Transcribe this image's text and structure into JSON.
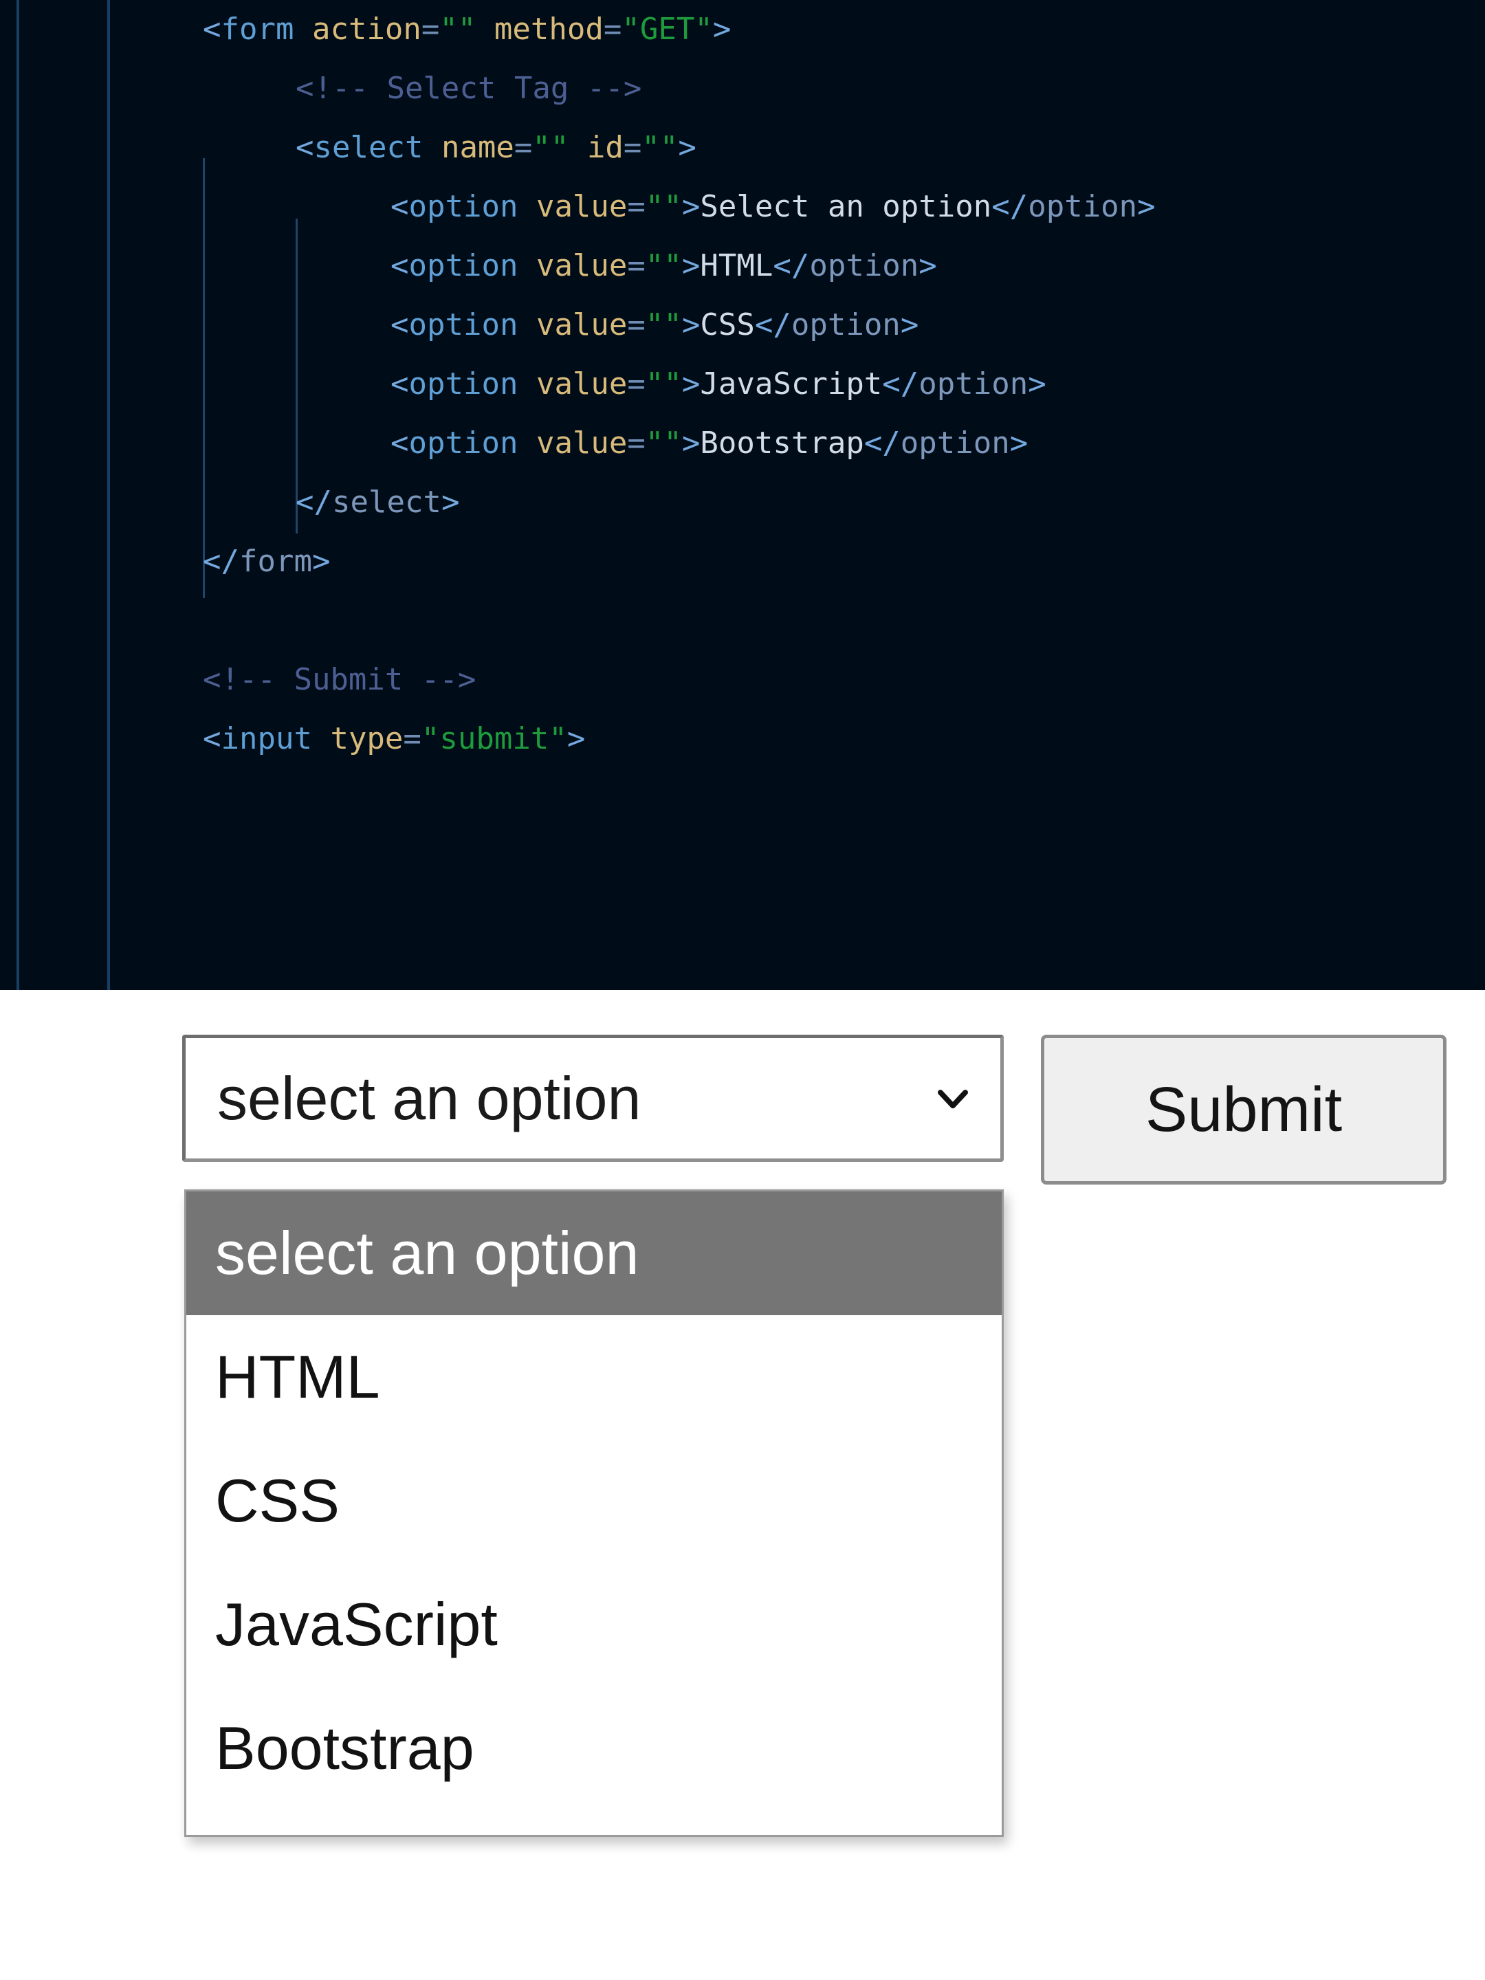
{
  "editor": {
    "background": "#000c18",
    "language": "html",
    "lines": [
      {
        "indent": 0,
        "tokens": [
          {
            "t": "pnct",
            "s": "<"
          },
          {
            "t": "tag",
            "s": "form"
          },
          {
            "t": "txt",
            "s": " "
          },
          {
            "t": "attr",
            "s": "action"
          },
          {
            "t": "eq",
            "s": "="
          },
          {
            "t": "str",
            "s": "\"\""
          },
          {
            "t": "txt",
            "s": " "
          },
          {
            "t": "attr",
            "s": "method"
          },
          {
            "t": "eq",
            "s": "="
          },
          {
            "t": "str",
            "s": "\"GET\""
          },
          {
            "t": "pnct",
            "s": ">"
          }
        ]
      },
      {
        "indent": 1,
        "tokens": [
          {
            "t": "cmt",
            "s": "<!-- Select Tag -->"
          }
        ]
      },
      {
        "indent": 1,
        "tokens": [
          {
            "t": "pnct",
            "s": "<"
          },
          {
            "t": "tag",
            "s": "select"
          },
          {
            "t": "txt",
            "s": " "
          },
          {
            "t": "attr",
            "s": "name"
          },
          {
            "t": "eq",
            "s": "="
          },
          {
            "t": "str",
            "s": "\"\""
          },
          {
            "t": "txt",
            "s": " "
          },
          {
            "t": "attr",
            "s": "id"
          },
          {
            "t": "eq",
            "s": "="
          },
          {
            "t": "str",
            "s": "\"\""
          },
          {
            "t": "pnct",
            "s": ">"
          }
        ]
      },
      {
        "indent": 2,
        "tokens": [
          {
            "t": "pnct",
            "s": "<"
          },
          {
            "t": "tag",
            "s": "option"
          },
          {
            "t": "txt",
            "s": " "
          },
          {
            "t": "attr",
            "s": "value"
          },
          {
            "t": "eq",
            "s": "="
          },
          {
            "t": "str",
            "s": "\"\""
          },
          {
            "t": "pnct",
            "s": ">"
          },
          {
            "t": "txt",
            "s": "Select an option"
          },
          {
            "t": "pnct",
            "s": "</"
          },
          {
            "t": "tagc",
            "s": "option"
          },
          {
            "t": "pnct",
            "s": ">"
          }
        ]
      },
      {
        "indent": 2,
        "tokens": [
          {
            "t": "pnct",
            "s": "<"
          },
          {
            "t": "tag",
            "s": "option"
          },
          {
            "t": "txt",
            "s": " "
          },
          {
            "t": "attr",
            "s": "value"
          },
          {
            "t": "eq",
            "s": "="
          },
          {
            "t": "str",
            "s": "\"\""
          },
          {
            "t": "pnct",
            "s": ">"
          },
          {
            "t": "txt",
            "s": "HTML"
          },
          {
            "t": "pnct",
            "s": "</"
          },
          {
            "t": "tagc",
            "s": "option"
          },
          {
            "t": "pnct",
            "s": ">"
          }
        ]
      },
      {
        "indent": 2,
        "tokens": [
          {
            "t": "pnct",
            "s": "<"
          },
          {
            "t": "tag",
            "s": "option"
          },
          {
            "t": "txt",
            "s": " "
          },
          {
            "t": "attr",
            "s": "value"
          },
          {
            "t": "eq",
            "s": "="
          },
          {
            "t": "str",
            "s": "\"\""
          },
          {
            "t": "pnct",
            "s": ">"
          },
          {
            "t": "txt",
            "s": "CSS"
          },
          {
            "t": "pnct",
            "s": "</"
          },
          {
            "t": "tagc",
            "s": "option"
          },
          {
            "t": "pnct",
            "s": ">"
          }
        ]
      },
      {
        "indent": 2,
        "tokens": [
          {
            "t": "pnct",
            "s": "<"
          },
          {
            "t": "tag",
            "s": "option"
          },
          {
            "t": "txt",
            "s": " "
          },
          {
            "t": "attr",
            "s": "value"
          },
          {
            "t": "eq",
            "s": "="
          },
          {
            "t": "str",
            "s": "\"\""
          },
          {
            "t": "pnct",
            "s": ">"
          },
          {
            "t": "txt",
            "s": "JavaScript"
          },
          {
            "t": "pnct",
            "s": "</"
          },
          {
            "t": "tagc",
            "s": "option"
          },
          {
            "t": "pnct",
            "s": ">"
          }
        ]
      },
      {
        "indent": 2,
        "tokens": [
          {
            "t": "pnct",
            "s": "<"
          },
          {
            "t": "tag",
            "s": "option"
          },
          {
            "t": "txt",
            "s": " "
          },
          {
            "t": "attr",
            "s": "value"
          },
          {
            "t": "eq",
            "s": "="
          },
          {
            "t": "str",
            "s": "\"\""
          },
          {
            "t": "pnct",
            "s": ">"
          },
          {
            "t": "txt",
            "s": "Bootstrap"
          },
          {
            "t": "pnct",
            "s": "</"
          },
          {
            "t": "tagc",
            "s": "option"
          },
          {
            "t": "pnct",
            "s": ">"
          }
        ]
      },
      {
        "indent": 1,
        "tokens": [
          {
            "t": "pnct",
            "s": "</"
          },
          {
            "t": "tagc",
            "s": "select"
          },
          {
            "t": "pnct",
            "s": ">"
          }
        ]
      },
      {
        "indent": 0,
        "tokens": [
          {
            "t": "pnct",
            "s": "</"
          },
          {
            "t": "tagc",
            "s": "form"
          },
          {
            "t": "pnct",
            "s": ">"
          }
        ]
      },
      {
        "indent": 0,
        "tokens": []
      },
      {
        "indent": 0,
        "tokens": [
          {
            "t": "cmt",
            "s": "<!-- Submit -->"
          }
        ]
      },
      {
        "indent": 0,
        "tokens": [
          {
            "t": "pnct",
            "s": "<"
          },
          {
            "t": "tag",
            "s": "input"
          },
          {
            "t": "txt",
            "s": " "
          },
          {
            "t": "attr",
            "s": "type"
          },
          {
            "t": "eq",
            "s": "="
          },
          {
            "t": "str",
            "s": "\"submit\""
          },
          {
            "t": "pnct",
            "s": ">"
          }
        ]
      }
    ]
  },
  "preview": {
    "select": {
      "selected_value": "select an option",
      "dropdown_icon": "chevron-down-icon",
      "expanded": true,
      "options": [
        {
          "label": "select an option",
          "highlighted": true
        },
        {
          "label": "HTML",
          "highlighted": false
        },
        {
          "label": "CSS",
          "highlighted": false
        },
        {
          "label": "JavaScript",
          "highlighted": false
        },
        {
          "label": "Bootstrap",
          "highlighted": false
        }
      ]
    },
    "submit_button": {
      "label": "Submit"
    }
  },
  "colors": {
    "editor_background": "#000c18",
    "tag": "#5f9fd4",
    "attribute": "#d8ba7b",
    "string": "#1e9b3c",
    "comment": "#4d5f92",
    "text": "#d3dbe6",
    "highlight": "#757575",
    "button_face": "#efefef"
  }
}
